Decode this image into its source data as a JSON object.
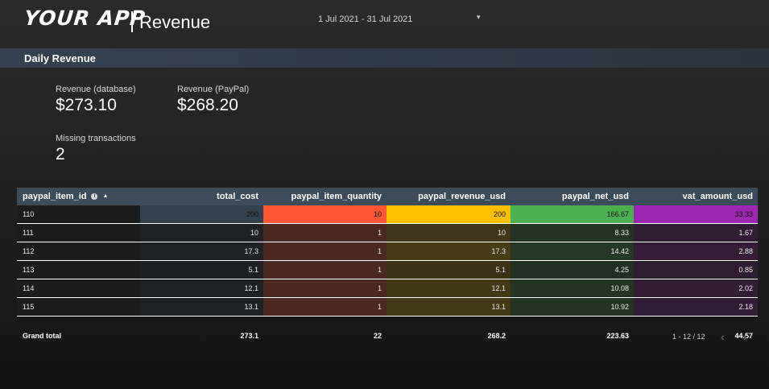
{
  "header": {
    "logo_text": "YOUR APP",
    "page_title": "Revenue",
    "date_range": "1 Jul 2021 - 31 Jul 2021",
    "date_caret": "▾"
  },
  "section": {
    "title": "Daily Revenue"
  },
  "metrics": {
    "revenue_db": {
      "label": "Revenue (database)",
      "value": "$273.10"
    },
    "revenue_paypal": {
      "label": "Revenue (PayPal)",
      "value": "$268.20"
    },
    "missing": {
      "label": "Missing transactions",
      "value": "2"
    }
  },
  "table": {
    "columns": [
      "paypal_item_id",
      "total_cost",
      "paypal_item_quantity",
      "paypal_revenue_usd",
      "paypal_net_usd",
      "vat_amount_usd"
    ],
    "info_icon": "i",
    "sort_icon": "▲",
    "rows": [
      [
        "110",
        "200",
        "10",
        "200",
        "166.67",
        "33.33"
      ],
      [
        "111",
        "10",
        "1",
        "10",
        "8.33",
        "1.67"
      ],
      [
        "112",
        "17.3",
        "1",
        "17.3",
        "14.42",
        "2.88"
      ],
      [
        "113",
        "5.1",
        "1",
        "5.1",
        "4.25",
        "0.85"
      ],
      [
        "114",
        "12.1",
        "1",
        "12.1",
        "10.08",
        "2.02"
      ],
      [
        "115",
        "13.1",
        "1",
        "13.1",
        "10.92",
        "2.18"
      ]
    ],
    "grand_total": [
      "Grand total",
      "273.1",
      "22",
      "268.2",
      "223.63",
      "44.57"
    ],
    "heat_colors": [
      "#34414f",
      "#ff5733",
      "#ffc000",
      "#4caf50",
      "#9c27b0"
    ]
  },
  "pagination": {
    "label": "1 - 12 / 12",
    "prev": "‹",
    "next": "›"
  }
}
